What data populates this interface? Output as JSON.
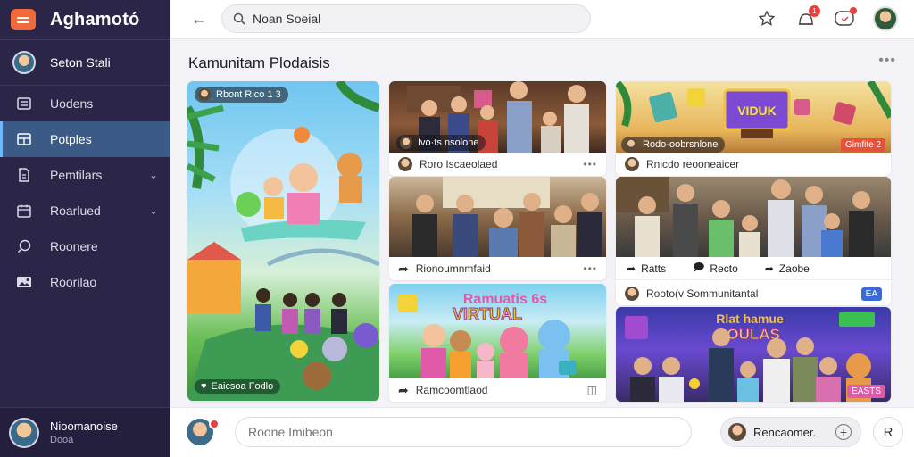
{
  "app": {
    "name": "Aghamotó"
  },
  "sidebar": {
    "user_name": "Seton Stali",
    "items": [
      {
        "label": "Uodens",
        "icon": "list-icon"
      },
      {
        "label": "Potples",
        "icon": "grid-icon"
      },
      {
        "label": "Pemtilars",
        "icon": "document-icon"
      },
      {
        "label": "Roarlued",
        "icon": "calendar-icon"
      },
      {
        "label": "Roonere",
        "icon": "chat-icon"
      },
      {
        "label": "Roorilao",
        "icon": "media-icon"
      }
    ],
    "footer": {
      "name": "Nioomanoise",
      "sub": "Dooa"
    }
  },
  "topbar": {
    "search_value": "Noan Soeial",
    "notif_count": "1"
  },
  "main": {
    "title": "Kamunitam Plodaisis",
    "cards": {
      "hero": {
        "chip": "Rbont Rico 1 3",
        "footer": "Eaicsoa Fodlo"
      },
      "family1": {
        "chip": "Ivo·ts nsolone",
        "footer": "Roro Iscaeolaed"
      },
      "virtual_tv": {
        "sign": "VIDUK",
        "chip": "Rodo·oobrsnlone",
        "tag": "Gimfite 2",
        "footer": "Rnicdo reooneaicer"
      },
      "group2": {
        "footer": "Rionoumnmfaid"
      },
      "group3": {
        "actions": [
          "Ratts",
          "Recto",
          "Zaobe"
        ],
        "footer": "Rooto(v Sommunitantal",
        "tag": "EA"
      },
      "virtual_kids": {
        "title1": "Ramuatis 6s",
        "title2": "VIRTUAL",
        "footer": "Ramcoomtlaod"
      },
      "fun_party": {
        "title1": "Rlat hamue",
        "title2": "ROULAS",
        "tag": "EASTS"
      }
    }
  },
  "composer": {
    "placeholder": "Roone Imibeon",
    "pill_label": "Rencaomer.",
    "right_btn": "R"
  }
}
